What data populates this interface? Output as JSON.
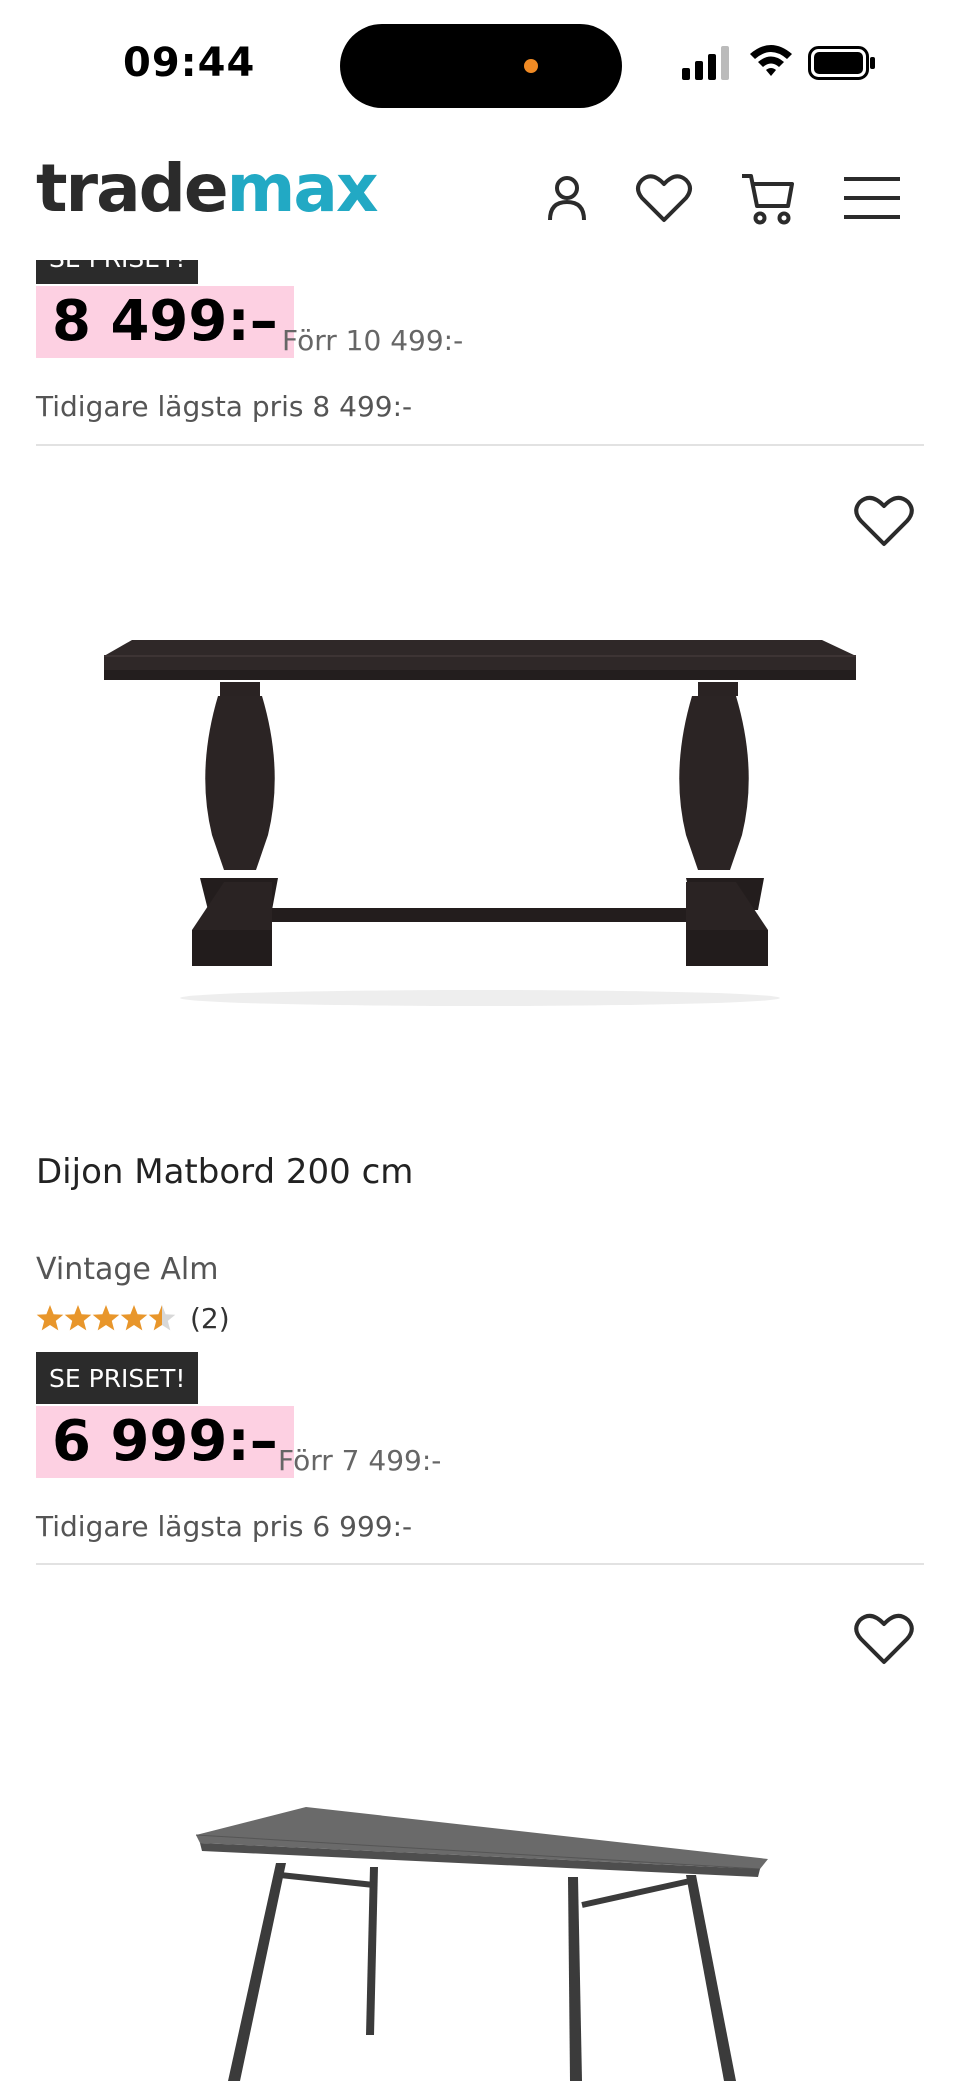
{
  "status": {
    "time": "09:44"
  },
  "header": {
    "logo_part1": "trade",
    "logo_part2": "max"
  },
  "products": [
    {
      "badge": "SE PRISET!",
      "price": "8 499:–",
      "was_price": "Förr 10 499:-",
      "lowest_price": "Tidigare lägsta pris 8 499:-"
    },
    {
      "name": "Dijon Matbord 200 cm",
      "variant": "Vintage Alm",
      "rating": 4.5,
      "review_count": "(2)",
      "badge": "SE PRISET!",
      "price": "6 999:–",
      "was_price": "Förr 7 499:-",
      "lowest_price": "Tidigare lägsta pris 6 999:-"
    }
  ],
  "colors": {
    "accent": "#22a9c4",
    "price_bg": "#fdd0e2",
    "badge_bg": "#2b2b2b",
    "star": "#e8962b"
  }
}
